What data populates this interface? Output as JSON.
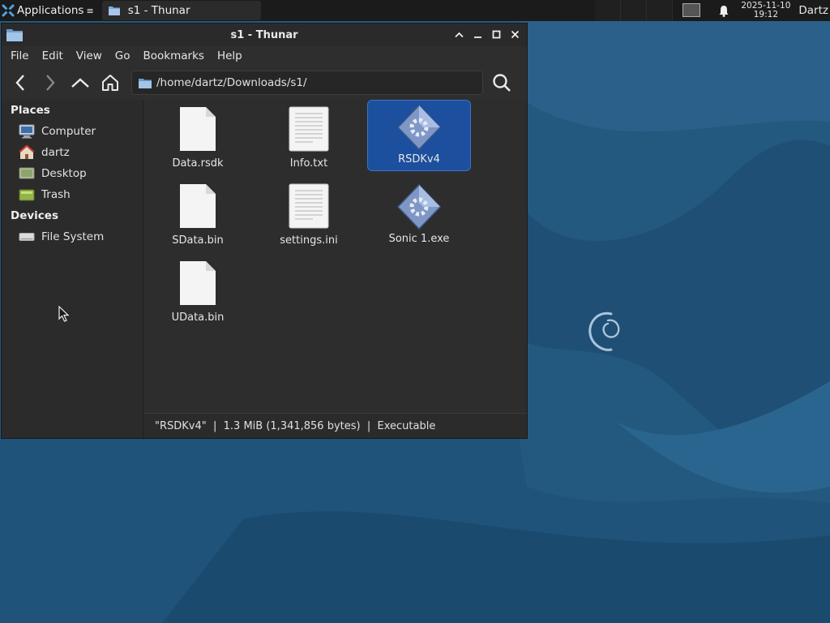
{
  "panel": {
    "applications_label": "Applications",
    "task_label": "s1 - Thunar",
    "clock_date": "2025-11-10",
    "clock_time": "19:12",
    "user": "Dartz"
  },
  "window": {
    "title": "s1 - Thunar",
    "menu": [
      "File",
      "Edit",
      "View",
      "Go",
      "Bookmarks",
      "Help"
    ],
    "location": "/home/dartz/Downloads/s1/"
  },
  "sidebar": {
    "places_heading": "Places",
    "places": [
      {
        "label": "Computer",
        "icon": "computer-icon"
      },
      {
        "label": "dartz",
        "icon": "home-icon"
      },
      {
        "label": "Desktop",
        "icon": "desktop-icon"
      },
      {
        "label": "Trash",
        "icon": "trash-icon"
      }
    ],
    "devices_heading": "Devices",
    "devices": [
      {
        "label": "File System",
        "icon": "drive-icon"
      }
    ]
  },
  "files": [
    {
      "name": "Data.rsdk",
      "icon": "blank-file-icon",
      "selected": false
    },
    {
      "name": "Info.txt",
      "icon": "text-file-icon",
      "selected": false
    },
    {
      "name": "RSDKv4",
      "icon": "executable-icon",
      "selected": true
    },
    {
      "name": "SData.bin",
      "icon": "blank-file-icon",
      "selected": false
    },
    {
      "name": "settings.ini",
      "icon": "text-file-icon",
      "selected": false
    },
    {
      "name": "Sonic 1.exe",
      "icon": "executable-icon",
      "selected": false
    },
    {
      "name": "UData.bin",
      "icon": "blank-file-icon",
      "selected": false
    }
  ],
  "status": "\"RSDKv4\"  |  1.3 MiB (1,341,856 bytes)  |  Executable",
  "colors": {
    "desktop": "#24597f",
    "selection": "#1c4f9e",
    "window_bg": "#2e2e2e"
  }
}
